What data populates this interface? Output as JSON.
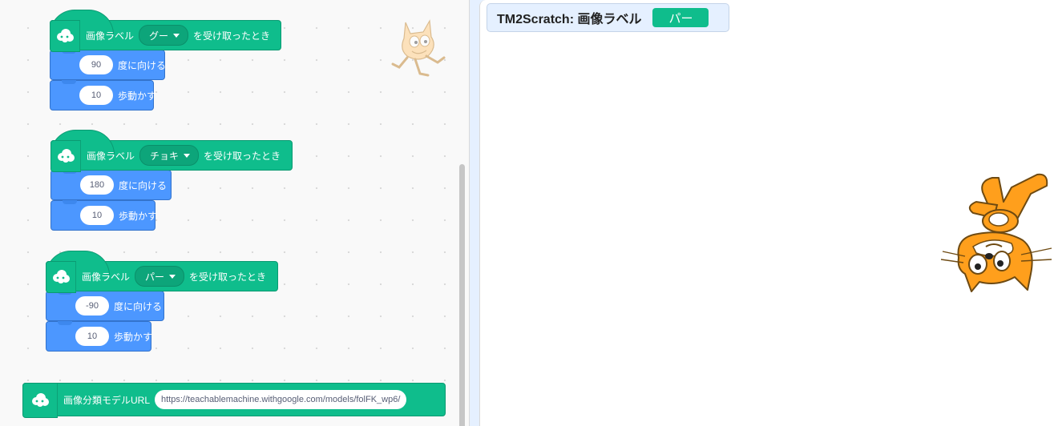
{
  "workspace": {
    "scripts": [
      {
        "hat": {
          "text_before": "画像ラベル",
          "dropdown": "グー",
          "text_after": "を受け取ったとき"
        },
        "turn": {
          "value": "90",
          "label": "度に向ける"
        },
        "move": {
          "value": "10",
          "label": "歩動かす"
        }
      },
      {
        "hat": {
          "text_before": "画像ラベル",
          "dropdown": "チョキ",
          "text_after": "を受け取ったとき"
        },
        "turn": {
          "value": "180",
          "label": "度に向ける"
        },
        "move": {
          "value": "10",
          "label": "歩動かす"
        }
      },
      {
        "hat": {
          "text_before": "画像ラベル",
          "dropdown": "パー",
          "text_after": "を受け取ったとき"
        },
        "turn": {
          "value": "-90",
          "label": "度に向ける"
        },
        "move": {
          "value": "10",
          "label": "歩動かす"
        }
      }
    ],
    "url_block": {
      "label": "画像分類モデルURL",
      "value": "https://teachablemachine.withgoogle.com/models/folFK_wp6/"
    }
  },
  "stage": {
    "monitor": {
      "label": "TM2Scratch: 画像ラベル",
      "value": "パー"
    }
  },
  "colors": {
    "extension_green": "#0fbd8c",
    "motion_blue": "#4c97ff",
    "stage_background": "#ffffff",
    "cat_orange": "#ff9f1c"
  },
  "icons": {
    "extension": "teachable-machine-icon",
    "sprite": "scratch-cat"
  }
}
